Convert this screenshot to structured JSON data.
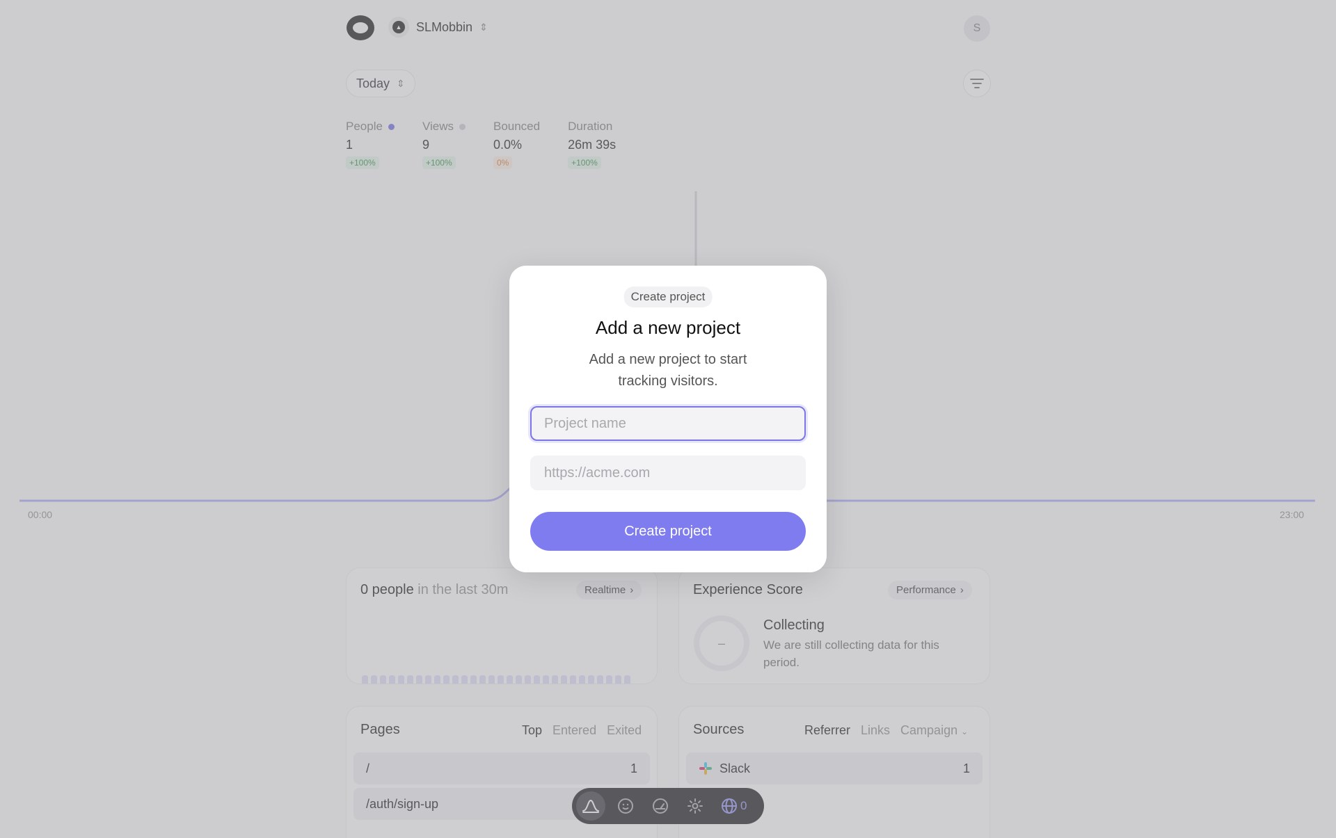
{
  "header": {
    "project_name": "SLMobbin",
    "avatar_initial": "S"
  },
  "filters": {
    "period": "Today"
  },
  "stats": [
    {
      "label": "People",
      "value": "1",
      "change": "+100%",
      "dot_color": "#6a66e0"
    },
    {
      "label": "Views",
      "value": "9",
      "change": "+100%",
      "dot_color": "#c8c8cc"
    },
    {
      "label": "Bounced",
      "value": "0.0%",
      "change": "0%"
    },
    {
      "label": "Duration",
      "value": "26m 39s",
      "change": "+100%"
    }
  ],
  "chart": {
    "start_label": "00:00",
    "end_label": "23:00"
  },
  "realtime_card": {
    "count": "0 people",
    "suffix": " in the last 30m",
    "link": "Realtime"
  },
  "experience_card": {
    "title": "Experience Score",
    "link": "Performance",
    "gauge_value": "–",
    "status_title": "Collecting",
    "status_text": "We are still collecting data for this period."
  },
  "pages_card": {
    "title": "Pages",
    "tabs": [
      "Top",
      "Entered",
      "Exited"
    ],
    "rows": [
      {
        "path": "/",
        "count": "1"
      },
      {
        "path": "/auth/sign-up",
        "count": ""
      }
    ]
  },
  "sources_card": {
    "title": "Sources",
    "tabs": [
      "Referrer",
      "Links",
      "Campaign"
    ],
    "rows": [
      {
        "name": "Slack",
        "count": "1"
      }
    ]
  },
  "dock": {
    "globe_count": "0"
  },
  "modal": {
    "tag": "Create project",
    "title": "Add a new project",
    "description": "Add a new project to start tracking visitors.",
    "name_placeholder": "Project name",
    "url_placeholder": "https://acme.com",
    "submit_label": "Create project"
  },
  "colors": {
    "accent": "#7f7cf0",
    "positive": "#2d8a3e",
    "neutral_change": "#d3742a"
  }
}
